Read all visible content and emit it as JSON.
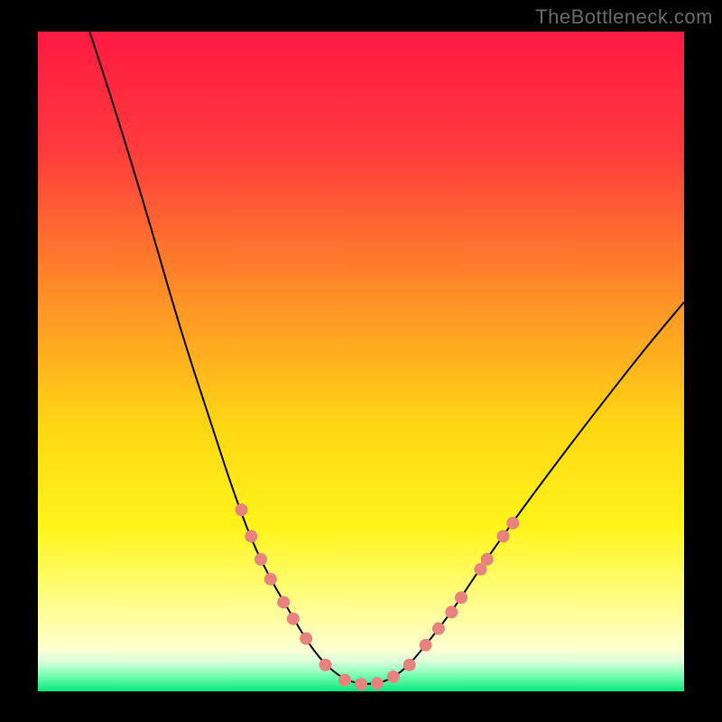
{
  "watermark": "TheBottleneck.com",
  "chart_data": {
    "type": "line",
    "title": "",
    "xlabel": "",
    "ylabel": "",
    "xlim": [
      0,
      100
    ],
    "ylim": [
      0,
      100
    ],
    "background_gradient": {
      "stops": [
        {
          "offset": 0.0,
          "color": "#ff1a42"
        },
        {
          "offset": 0.18,
          "color": "#ff3b3c"
        },
        {
          "offset": 0.43,
          "color": "#ff9a24"
        },
        {
          "offset": 0.6,
          "color": "#ffd714"
        },
        {
          "offset": 0.75,
          "color": "#fff41a"
        },
        {
          "offset": 0.85,
          "color": "#fffe7a"
        },
        {
          "offset": 0.935,
          "color": "#ffffd0"
        },
        {
          "offset": 0.955,
          "color": "#d9ffd9"
        },
        {
          "offset": 0.975,
          "color": "#7dffb5"
        },
        {
          "offset": 1.0,
          "color": "#06e77a"
        }
      ]
    },
    "series": [
      {
        "name": "bottleneck-curve",
        "stroke": "#000000",
        "stroke_width": 2,
        "data": [
          {
            "x": 8,
            "y": 100
          },
          {
            "x": 12,
            "y": 88
          },
          {
            "x": 17,
            "y": 72
          },
          {
            "x": 22,
            "y": 55
          },
          {
            "x": 27,
            "y": 40
          },
          {
            "x": 30,
            "y": 31
          },
          {
            "x": 33,
            "y": 23
          },
          {
            "x": 36,
            "y": 17
          },
          {
            "x": 39,
            "y": 12
          },
          {
            "x": 42,
            "y": 7
          },
          {
            "x": 45,
            "y": 3.5
          },
          {
            "x": 48,
            "y": 1.5
          },
          {
            "x": 51,
            "y": 1.0
          },
          {
            "x": 54,
            "y": 1.5
          },
          {
            "x": 57,
            "y": 3.5
          },
          {
            "x": 60,
            "y": 7
          },
          {
            "x": 64,
            "y": 12
          },
          {
            "x": 68,
            "y": 18
          },
          {
            "x": 73,
            "y": 25
          },
          {
            "x": 79,
            "y": 33
          },
          {
            "x": 86,
            "y": 42
          },
          {
            "x": 94,
            "y": 52
          },
          {
            "x": 100,
            "y": 59
          }
        ]
      }
    ],
    "markers": {
      "color": "#e8827f",
      "radius": 7,
      "points": [
        {
          "x": 31.5,
          "y": 27.5
        },
        {
          "x": 33.0,
          "y": 23.5
        },
        {
          "x": 34.5,
          "y": 20.0
        },
        {
          "x": 36.0,
          "y": 17.0
        },
        {
          "x": 38.0,
          "y": 13.5
        },
        {
          "x": 39.5,
          "y": 11.0
        },
        {
          "x": 41.5,
          "y": 8.0
        },
        {
          "x": 44.5,
          "y": 4.0
        },
        {
          "x": 47.5,
          "y": 1.7
        },
        {
          "x": 50.0,
          "y": 1.1
        },
        {
          "x": 52.5,
          "y": 1.2
        },
        {
          "x": 55.0,
          "y": 2.2
        },
        {
          "x": 57.5,
          "y": 4.0
        },
        {
          "x": 60.0,
          "y": 7.0
        },
        {
          "x": 62.0,
          "y": 9.5
        },
        {
          "x": 64.0,
          "y": 12.0
        },
        {
          "x": 65.5,
          "y": 14.2
        },
        {
          "x": 68.5,
          "y": 18.5
        },
        {
          "x": 69.5,
          "y": 20.0
        },
        {
          "x": 72.0,
          "y": 23.5
        },
        {
          "x": 73.5,
          "y": 25.5
        }
      ]
    }
  }
}
